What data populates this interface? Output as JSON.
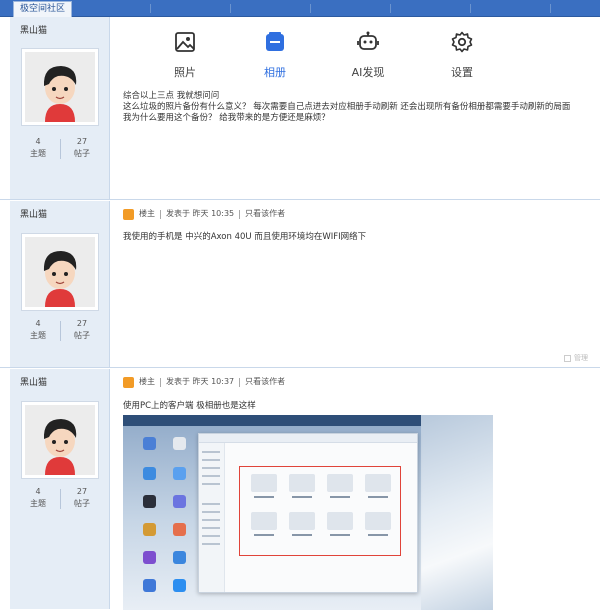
{
  "topbar": {
    "tab_label": "极空间社区"
  },
  "phone_nav": {
    "items": [
      {
        "label": "照片",
        "icon": "image-icon",
        "active": false
      },
      {
        "label": "相册",
        "icon": "album-icon",
        "active": true
      },
      {
        "label": "AI发现",
        "icon": "robot-icon",
        "active": false
      },
      {
        "label": "设置",
        "icon": "gear-icon",
        "active": false
      }
    ],
    "active_color": "#2f6fe0"
  },
  "posts": [
    {
      "username": "黑山猫",
      "stats": {
        "topics": "4",
        "topics_label": "主题",
        "posts": "27",
        "posts_label": "帖子"
      },
      "lines": [
        "综合以上三点 我就想问问",
        "这么垃圾的照片备份有什么意义？ 每次需要自己点进去对应相册手动刷新 还会出现所有备份相册都需要手动刷新的局面",
        "我为什么要用这个备份？ 给我带来的是方便还是麻烦？"
      ]
    },
    {
      "username": "黑山猫",
      "stats": {
        "topics": "4",
        "topics_label": "主题",
        "posts": "27",
        "posts_label": "帖子"
      },
      "meta": {
        "role": "楼主",
        "posted": "发表于 昨天 10:35",
        "only_author": "只看该作者"
      },
      "lines": [
        "我使用的手机是 中兴的Axon 40U   而且使用环境均在WIFI网络下"
      ],
      "manage_label": "管理"
    },
    {
      "username": "黑山猫",
      "stats": {
        "topics": "4",
        "topics_label": "主题",
        "posts": "27",
        "posts_label": "帖子"
      },
      "meta": {
        "role": "楼主",
        "posted": "发表于 昨天 10:37",
        "only_author": "只看该作者"
      },
      "lines": [
        "使用PC上的客户端 极相册也是这样"
      ]
    }
  ],
  "colors": {
    "header_blue": "#3a6fc1",
    "sidebar_bg": "#e5edf6",
    "badge_orange": "#f29b26",
    "highlight_red": "#e0443a"
  }
}
